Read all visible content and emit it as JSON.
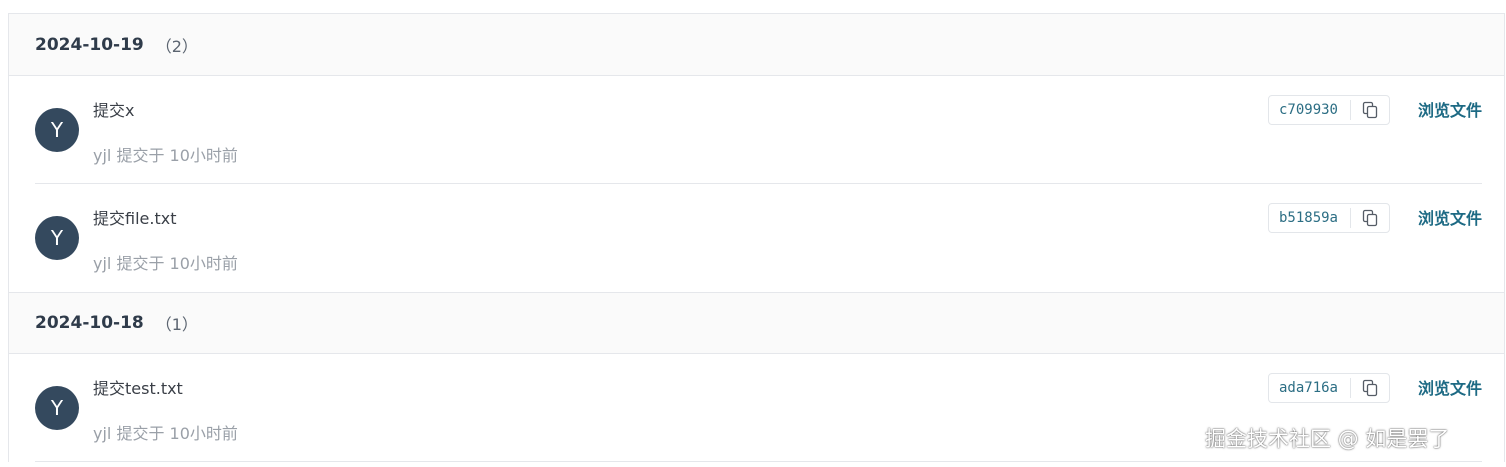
{
  "groups": [
    {
      "date": "2024-10-19",
      "count": "（2）",
      "commits": [
        {
          "avatar": "Y",
          "message": "提交x",
          "meta": "yjl 提交于 10小时前",
          "sha": "c709930",
          "browse_label": "浏览文件"
        },
        {
          "avatar": "Y",
          "message": "提交file.txt",
          "meta": "yjl 提交于 10小时前",
          "sha": "b51859a",
          "browse_label": "浏览文件"
        }
      ]
    },
    {
      "date": "2024-10-18",
      "count": "（1）",
      "commits": [
        {
          "avatar": "Y",
          "message": "提交test.txt",
          "meta": "yjl 提交于 10小时前",
          "sha": "ada716a",
          "browse_label": "浏览文件"
        }
      ]
    }
  ],
  "icons": {
    "copy": "copy-icon"
  },
  "colors": {
    "avatar_bg": "#34495e",
    "link": "#1d6a84",
    "sha": "#2c6e84"
  },
  "watermark": "掘金技术社区 @ 如是罢了"
}
